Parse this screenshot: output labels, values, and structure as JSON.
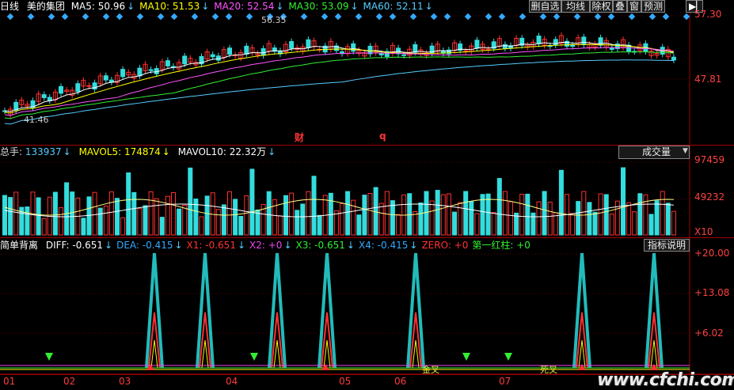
{
  "top": {
    "period": "日线",
    "stock": "美的集团",
    "ma": [
      {
        "label": "MA5: ",
        "value": "50.96",
        "arrow": "↓",
        "color": "#ffffff"
      },
      {
        "label": "MA10: ",
        "value": "51.53",
        "arrow": "↓",
        "color": "#ffff00"
      },
      {
        "label": "MA20: ",
        "value": "52.54",
        "arrow": "↓",
        "color": "#ff55ff"
      },
      {
        "label": "MA30: ",
        "value": "53.09",
        "arrow": "↓",
        "color": "#33ee33"
      },
      {
        "label": "MA60: ",
        "value": "52.11",
        "arrow": "↓",
        "color": "#55ccff"
      }
    ],
    "buttons": [
      "删自选",
      "均线",
      "除权",
      "叠",
      "窗",
      "预测"
    ],
    "price_axis": [
      "57.30",
      "47.81"
    ],
    "high_label": "56.35",
    "low_label": "41.46",
    "markers": [
      "财",
      "q"
    ]
  },
  "volume": {
    "title": "总手: ",
    "total": "133937",
    "mavol5_label": "MAVOL5: ",
    "mavol5": "174874",
    "mavol10_label": "MAVOL10: ",
    "mavol10": "22.32万",
    "arrow": "↓",
    "dropdown": "成交量",
    "axis": [
      "97459",
      "49232",
      "X10"
    ]
  },
  "indicator": {
    "name": "简单背离",
    "items": [
      {
        "label": "DIFF: ",
        "value": "-0.651",
        "color": "#ffffff"
      },
      {
        "label": "DEA: ",
        "value": "-0.415",
        "color": "#33aaff"
      },
      {
        "label": "X1: ",
        "value": "-0.651",
        "color": "#ff3333"
      },
      {
        "label": "X2: ",
        "value": "+0",
        "color": "#ee44ee"
      },
      {
        "label": "X3: ",
        "value": "-0.651",
        "color": "#33ee33"
      },
      {
        "label": "X4: ",
        "value": "-0.415",
        "color": "#33aaff"
      },
      {
        "label": "ZERO: ",
        "value": "+0",
        "color": "#ff3333"
      },
      {
        "label": "第一红柱: ",
        "value": "+0",
        "color": "#33ee33"
      }
    ],
    "arrow": "↓",
    "explain_button": "指标说明",
    "axis": [
      "+20.00",
      "+13.08",
      "+6.02"
    ],
    "signal_golden": "金叉",
    "signal_death": "死叉"
  },
  "months": [
    "01",
    "02",
    "03",
    "04",
    "05",
    "06",
    "07"
  ],
  "watermark": "www.cfchi.com"
}
